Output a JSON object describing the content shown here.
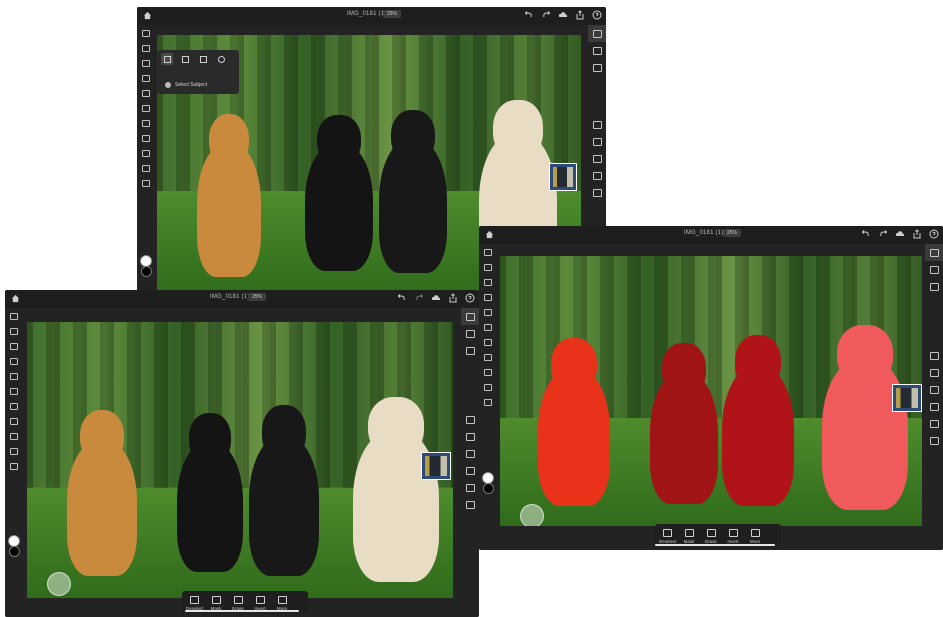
{
  "app": {
    "doc_title": "IMG_0181 (1)",
    "zoom": "25%"
  },
  "selection_popup": {
    "item_label": "Select Subject",
    "modes": [
      "select-subject-icon",
      "quick-select-brush-icon",
      "rect-marquee-icon",
      "ellipse-marquee-icon"
    ]
  },
  "bottom_toolbar": [
    {
      "label": "Deselect",
      "icon": "deselect-icon"
    },
    {
      "label": "Mask",
      "icon": "mask-icon"
    },
    {
      "label": "Erase",
      "icon": "eraser-icon"
    },
    {
      "label": "Invert",
      "icon": "invert-icon"
    },
    {
      "label": "More",
      "icon": "more-icon"
    }
  ],
  "colors": {
    "ui_bg": "#232323",
    "selection_overlay": "#ff1a1a",
    "canvas_grass": "#4f8c2c"
  }
}
